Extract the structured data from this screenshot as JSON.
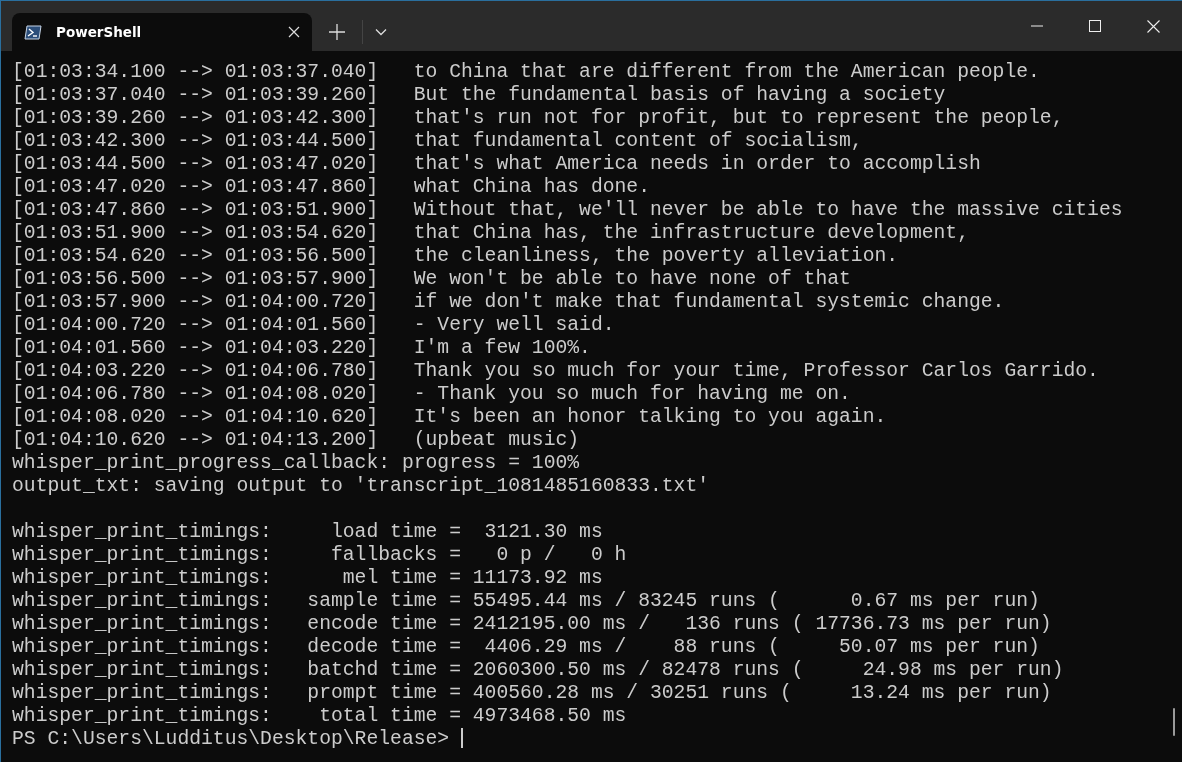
{
  "tabs": [
    {
      "title": "PowerShell",
      "selected": true
    }
  ],
  "transcript": [
    "[01:03:34.100 --> 01:03:37.040]   to China that are different from the American people.",
    "[01:03:37.040 --> 01:03:39.260]   But the fundamental basis of having a society",
    "[01:03:39.260 --> 01:03:42.300]   that's run not for profit, but to represent the people,",
    "[01:03:42.300 --> 01:03:44.500]   that fundamental content of socialism,",
    "[01:03:44.500 --> 01:03:47.020]   that's what America needs in order to accomplish",
    "[01:03:47.020 --> 01:03:47.860]   what China has done.",
    "[01:03:47.860 --> 01:03:51.900]   Without that, we'll never be able to have the massive cities",
    "[01:03:51.900 --> 01:03:54.620]   that China has, the infrastructure development,",
    "[01:03:54.620 --> 01:03:56.500]   the cleanliness, the poverty alleviation.",
    "[01:03:56.500 --> 01:03:57.900]   We won't be able to have none of that",
    "[01:03:57.900 --> 01:04:00.720]   if we don't make that fundamental systemic change.",
    "[01:04:00.720 --> 01:04:01.560]   - Very well said.",
    "[01:04:01.560 --> 01:04:03.220]   I'm a few 100%.",
    "[01:04:03.220 --> 01:04:06.780]   Thank you so much for your time, Professor Carlos Garrido.",
    "[01:04:06.780 --> 01:04:08.020]   - Thank you so much for having me on.",
    "[01:04:08.020 --> 01:04:10.620]   It's been an honor talking to you again.",
    "[01:04:10.620 --> 01:04:13.200]   (upbeat music)"
  ],
  "messages": [
    "whisper_print_progress_callback: progress = 100%",
    "output_txt: saving output to 'transcript_1081485160833.txt'"
  ],
  "timings": [
    "whisper_print_timings:     load time =  3121.30 ms",
    "whisper_print_timings:     fallbacks =   0 p /   0 h",
    "whisper_print_timings:      mel time = 11173.92 ms",
    "whisper_print_timings:   sample time = 55495.44 ms / 83245 runs (      0.67 ms per run)",
    "whisper_print_timings:   encode time = 2412195.00 ms /   136 runs ( 17736.73 ms per run)",
    "whisper_print_timings:   decode time =  4406.29 ms /    88 runs (     50.07 ms per run)",
    "whisper_print_timings:   batchd time = 2060300.50 ms / 82478 runs (     24.98 ms per run)",
    "whisper_print_timings:   prompt time = 400560.28 ms / 30251 runs (     13.24 ms per run)",
    "whisper_print_timings:    total time = 4973468.50 ms"
  ],
  "prompt": "PS C:\\Users\\Ludditus\\Desktop\\Release>"
}
